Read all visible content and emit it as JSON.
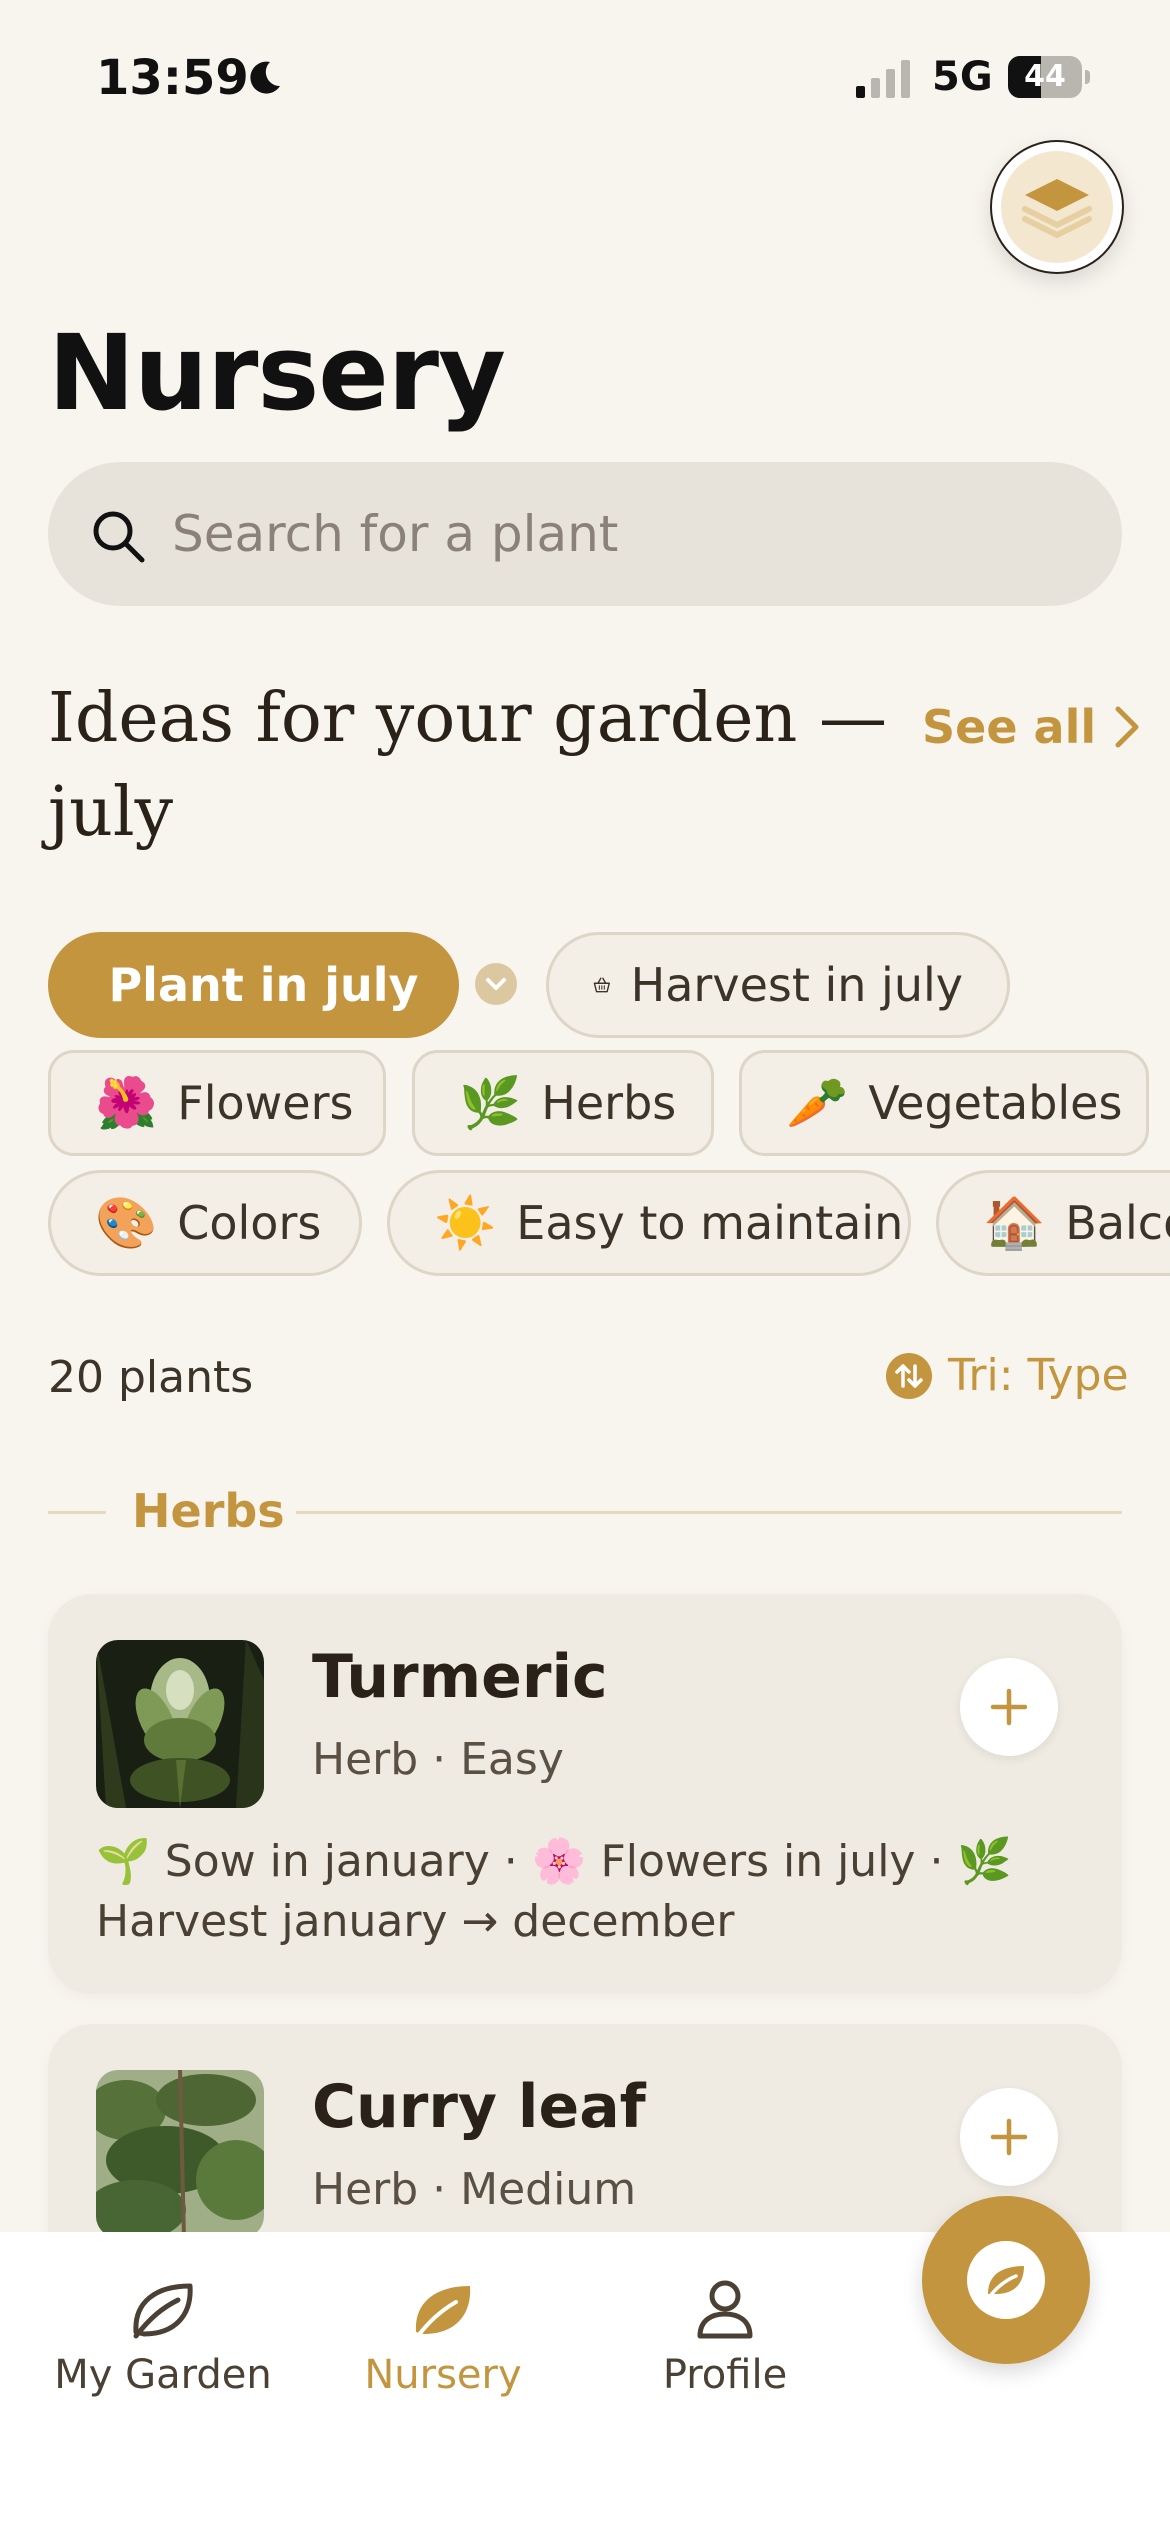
{
  "status_bar": {
    "time": "13:59",
    "network": "5G",
    "battery": "44",
    "battery_level": 0.44
  },
  "header": {
    "title": "Nursery"
  },
  "search": {
    "placeholder": "Search for a plant",
    "value": ""
  },
  "ideas": {
    "title": "Ideas for your garden — july",
    "see_all": "See all",
    "chips_row1": [
      {
        "label": "Plant in july",
        "icon": "leaf-icon",
        "active": true
      },
      {
        "label": "Harvest in july",
        "icon": "basket-icon",
        "active": false
      }
    ],
    "chips_row2": [
      {
        "emoji": "🌺",
        "label": "Flowers"
      },
      {
        "emoji": "🌿",
        "label": "Herbs"
      },
      {
        "emoji": "🥕",
        "label": "Vegetables"
      }
    ],
    "chips_row3": [
      {
        "emoji": "🎨",
        "label": "Colors"
      },
      {
        "emoji": "☀️",
        "label": "Easy to maintain"
      },
      {
        "emoji": "🏠",
        "label": "Balco"
      }
    ]
  },
  "list": {
    "count": "20 plants",
    "sort": "Tri: Type",
    "section": "Herbs",
    "plants": [
      {
        "name": "Turmeric",
        "meta": "Herb · Easy",
        "details": "🌱 Sow in january  ·  🌸 Flowers in july  ·  🌿 Harvest january → december"
      },
      {
        "name": "Curry leaf",
        "meta": "Herb · Medium"
      }
    ]
  },
  "tabs": [
    {
      "label": "My Garden",
      "icon": "leaf-outline-icon",
      "active": false
    },
    {
      "label": "Nursery",
      "icon": "leaf-filled-icon",
      "active": true
    },
    {
      "label": "Profile",
      "icon": "person-icon",
      "active": false
    }
  ],
  "colors": {
    "accent": "#c4953f",
    "background": "#f8f5ef",
    "card": "#f0ebe2",
    "text": "#2a2218"
  }
}
